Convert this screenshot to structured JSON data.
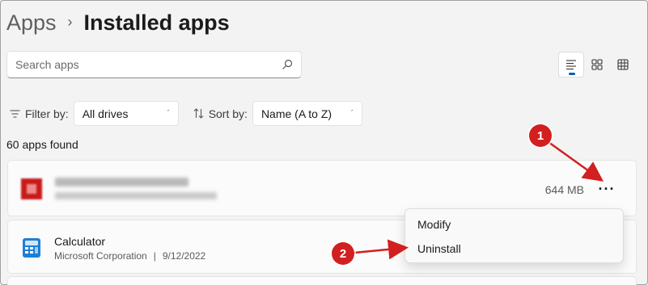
{
  "breadcrumb": {
    "parent": "Apps",
    "separator": "›",
    "current": "Installed apps"
  },
  "search": {
    "placeholder": "Search apps",
    "value": ""
  },
  "view_modes": [
    {
      "name": "list",
      "active": true
    },
    {
      "name": "tiles",
      "active": false
    },
    {
      "name": "grid",
      "active": false
    }
  ],
  "filter": {
    "label": "Filter by:",
    "value": "All drives"
  },
  "sort": {
    "label": "Sort by:",
    "value": "Name (A to Z)"
  },
  "apps_count": "60 apps found",
  "apps": [
    {
      "name": "",
      "blurred": true,
      "size": "644 MB",
      "more_label": "···"
    },
    {
      "name": "Calculator",
      "publisher": "Microsoft Corporation",
      "separator": "|",
      "date": "9/12/2022"
    }
  ],
  "context_menu": {
    "items": [
      "Modify",
      "Uninstall"
    ]
  },
  "annotations": [
    {
      "number": "1",
      "target": "more-options-button"
    },
    {
      "number": "2",
      "target": "menu-item-uninstall"
    }
  ],
  "colors": {
    "accent": "#005fb8",
    "annotation": "#d21f1f",
    "background": "#f3f3f3",
    "card": "#fbfbfb"
  }
}
